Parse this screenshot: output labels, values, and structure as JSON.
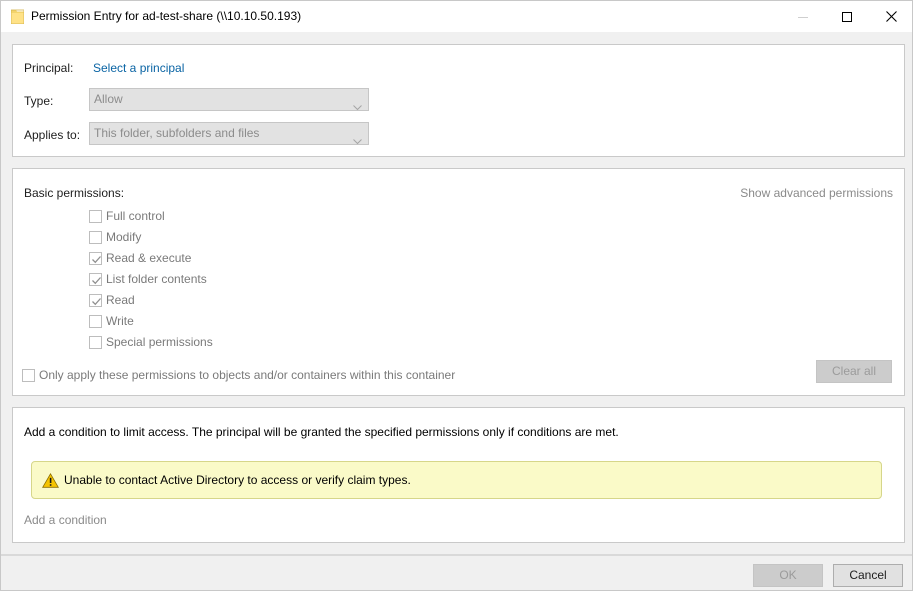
{
  "window": {
    "title": "Permission Entry for ad-test-share (\\\\10.10.50.193)"
  },
  "principal": {
    "label": "Principal:",
    "link": "Select a principal"
  },
  "type": {
    "label": "Type:",
    "value": "Allow"
  },
  "applies_to": {
    "label": "Applies to:",
    "value": "This folder, subfolders and files"
  },
  "basic_permissions": {
    "heading": "Basic permissions:",
    "advanced_link": "Show advanced permissions",
    "items": [
      {
        "label": "Full control",
        "checked": false
      },
      {
        "label": "Modify",
        "checked": false
      },
      {
        "label": "Read & execute",
        "checked": true
      },
      {
        "label": "List folder contents",
        "checked": true
      },
      {
        "label": "Read",
        "checked": true
      },
      {
        "label": "Write",
        "checked": false
      },
      {
        "label": "Special permissions",
        "checked": false
      }
    ],
    "only_apply_label": "Only apply these permissions to objects and/or containers within this container",
    "only_apply_checked": false,
    "clear_all": "Clear all"
  },
  "condition": {
    "description": "Add a condition to limit access. The principal will be granted the specified permissions only if conditions are met.",
    "warning": "Unable to contact Active Directory to access or verify claim types.",
    "add_link": "Add a condition"
  },
  "footer": {
    "ok": "OK",
    "cancel": "Cancel"
  }
}
